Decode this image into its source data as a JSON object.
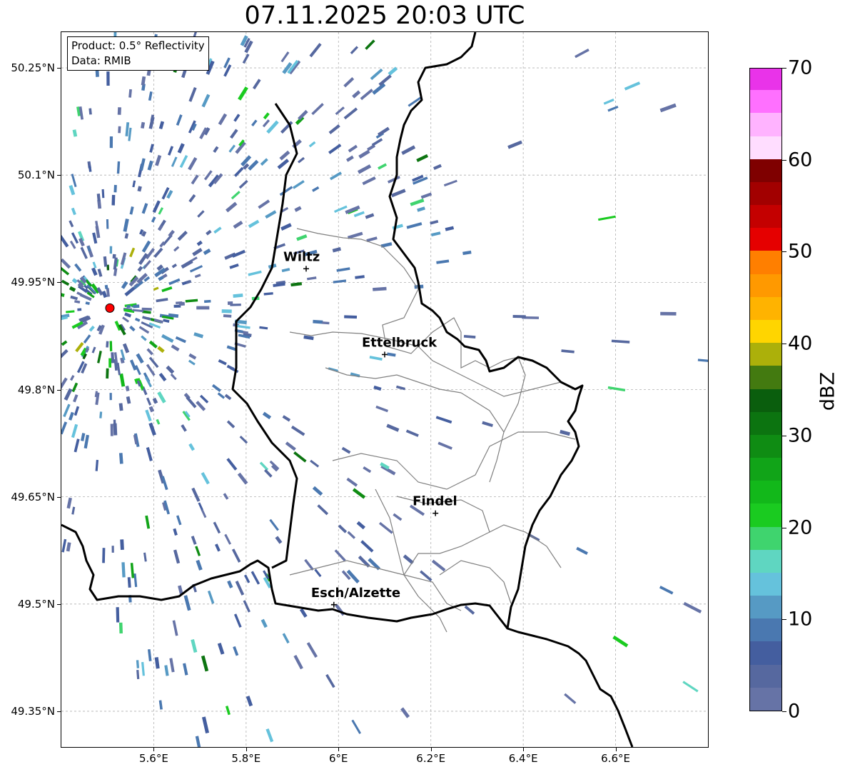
{
  "title": "07.11.2025 20:03 UTC",
  "info": {
    "product": "Product: 0.5° Reflectivity",
    "data": "Data: RMIB"
  },
  "map_extent": {
    "lon_min": 5.4,
    "lon_max": 6.8,
    "lat_min": 49.3,
    "lat_max": 50.3
  },
  "lat_ticks": [
    {
      "value": 50.25,
      "label": "50.25°N"
    },
    {
      "value": 50.1,
      "label": "50.1°N"
    },
    {
      "value": 49.95,
      "label": "49.95°N"
    },
    {
      "value": 49.8,
      "label": "49.8°N"
    },
    {
      "value": 49.65,
      "label": "49.65°N"
    },
    {
      "value": 49.5,
      "label": "49.5°N"
    },
    {
      "value": 49.35,
      "label": "49.35°N"
    }
  ],
  "lon_ticks": [
    {
      "value": 5.6,
      "label": "5.6°E"
    },
    {
      "value": 5.8,
      "label": "5.8°E"
    },
    {
      "value": 6.0,
      "label": "6°E"
    },
    {
      "value": 6.2,
      "label": "6.2°E"
    },
    {
      "value": 6.4,
      "label": "6.4°E"
    },
    {
      "value": 6.6,
      "label": "6.6°E"
    }
  ],
  "cities": [
    {
      "name": "Wiltz",
      "lon": 5.93,
      "lat": 49.969
    },
    {
      "name": "Ettelbruck",
      "lon": 6.1,
      "lat": 49.849
    },
    {
      "name": "Findel",
      "lon": 6.21,
      "lat": 49.627
    },
    {
      "name": "Esch/Alzette",
      "lon": 5.99,
      "lat": 49.499
    }
  ],
  "radar_site": {
    "lon": 5.505,
    "lat": 49.914,
    "color": "#ff0000"
  },
  "colorbar": {
    "label": "dBZ",
    "min": 0,
    "max": 70,
    "ticks": [
      "0",
      "10",
      "20",
      "30",
      "40",
      "50",
      "60",
      "70"
    ],
    "colors": [
      "#6673a6",
      "#56689f",
      "#445e9f",
      "#4a78b0",
      "#569ac4",
      "#65c2dc",
      "#5fd6c1",
      "#3fd46e",
      "#1acb20",
      "#12b81a",
      "#11a418",
      "#0f8c13",
      "#0c7410",
      "#0a5e0d",
      "#437a10",
      "#acb00a",
      "#ffd500",
      "#ffb300",
      "#ff9900",
      "#ff7f00",
      "#e50000",
      "#c40000",
      "#a20000",
      "#7f0000",
      "#ffddff",
      "#ffb3ff",
      "#ff70ff",
      "#e933e9"
    ]
  },
  "styles": {
    "border_color": "#000000",
    "admin_color": "#808080",
    "grid_color": "#b0b0b0"
  }
}
